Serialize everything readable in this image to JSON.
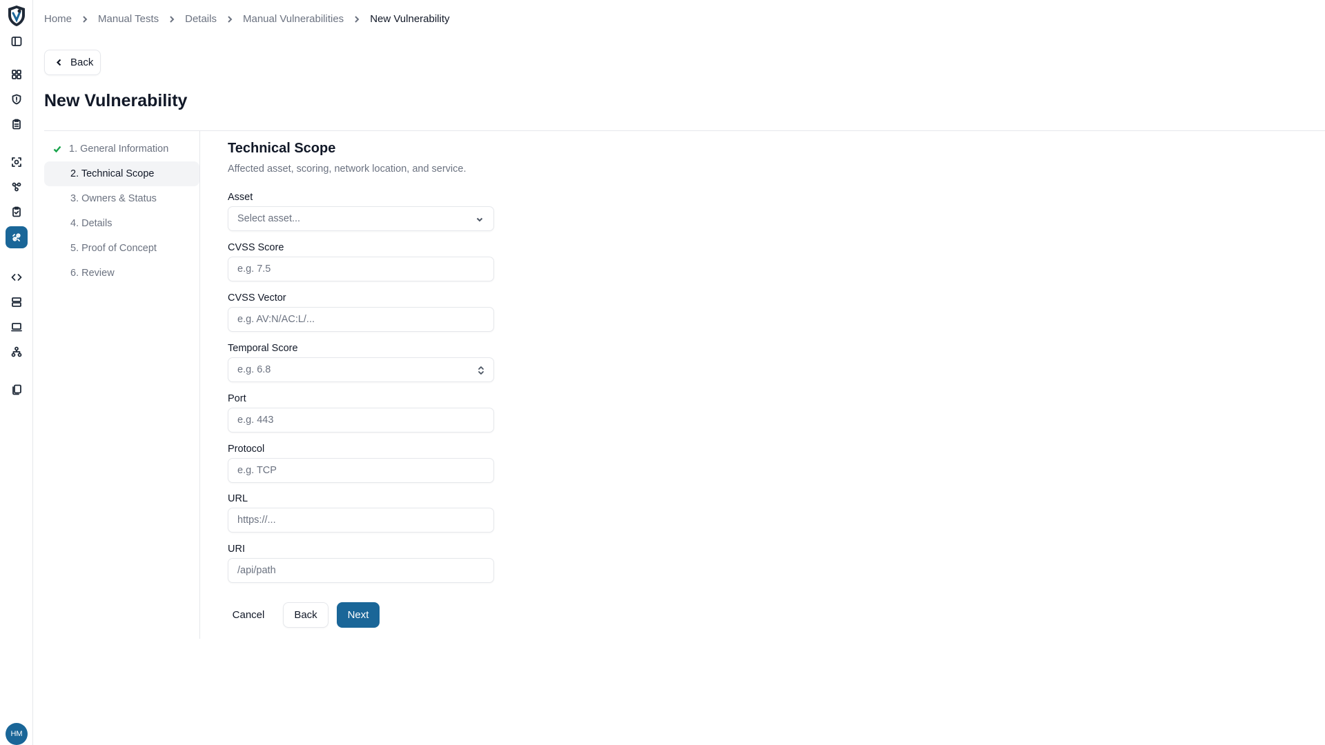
{
  "breadcrumb": {
    "items": [
      "Home",
      "Manual Tests",
      "Details",
      "Manual Vulnerabilities"
    ],
    "current": "New Vulnerability"
  },
  "back_button": {
    "label": "Back"
  },
  "page_title": "New Vulnerability",
  "steps": [
    {
      "label": "1. General Information",
      "state": "completed"
    },
    {
      "label": "2. Technical Scope",
      "state": "active"
    },
    {
      "label": "3. Owners & Status",
      "state": "pending"
    },
    {
      "label": "4. Details",
      "state": "pending"
    },
    {
      "label": "5. Proof of Concept",
      "state": "pending"
    },
    {
      "label": "6. Review",
      "state": "pending"
    }
  ],
  "section": {
    "title": "Technical Scope",
    "description": "Affected asset, scoring, network location, and service."
  },
  "fields": {
    "asset": {
      "label": "Asset",
      "placeholder": "Select asset..."
    },
    "cvss_score": {
      "label": "CVSS Score",
      "placeholder": "e.g. 7.5"
    },
    "cvss_vector": {
      "label": "CVSS Vector",
      "placeholder": "e.g. AV:N/AC:L/..."
    },
    "temporal_score": {
      "label": "Temporal Score",
      "placeholder": "e.g. 6.8"
    },
    "port": {
      "label": "Port",
      "placeholder": "e.g. 443"
    },
    "protocol": {
      "label": "Protocol",
      "placeholder": "e.g. TCP"
    },
    "url": {
      "label": "URL",
      "placeholder": "https://..."
    },
    "uri": {
      "label": "URI",
      "placeholder": "/api/path"
    }
  },
  "actions": {
    "cancel": "Cancel",
    "back": "Back",
    "next": "Next"
  },
  "user": {
    "initials": "HM"
  },
  "sidebar_icons": [
    "app-logo-icon",
    "panel-toggle-icon",
    "dashboard-icon",
    "shield-icon",
    "clipboard-icon",
    "scan-icon",
    "network-cluster-icon",
    "clipboard-check-icon",
    "bug-icon",
    "code-icon",
    "server-icon",
    "monitor-icon",
    "hierarchy-icon",
    "documents-icon"
  ],
  "colors": {
    "accent": "#1a6698",
    "success": "#16a34a",
    "muted_text": "#6b7280",
    "border": "#e5e7eb"
  }
}
